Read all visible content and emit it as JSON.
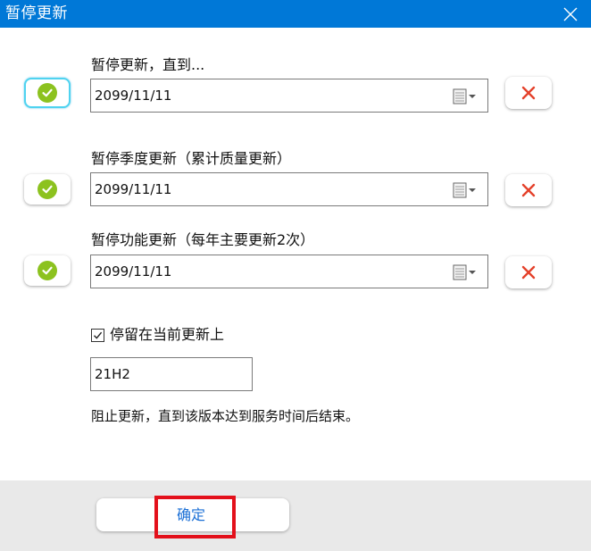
{
  "window": {
    "title": "暂停更新"
  },
  "sections": [
    {
      "label": "暂停更新，直到...",
      "date": "2099/11/11"
    },
    {
      "label": "暂停季度更新（累计质量更新）",
      "date": "2099/11/11"
    },
    {
      "label": "暂停功能更新（每年主要更新2次）",
      "date": "2099/11/11"
    }
  ],
  "stay": {
    "label": "停留在当前更新上",
    "checked": true,
    "version": "21H2"
  },
  "info": "阻止更新，直到该版本达到服务时间后结束。",
  "footer": {
    "ok_label": "确定"
  },
  "colors": {
    "titlebar": "#0078d7",
    "check_green": "#8cc21f",
    "x_red": "#e4412b",
    "ok_text": "#1a6fd6",
    "highlight": "#e3101b"
  },
  "icons": {
    "close": "close-icon",
    "check": "checkmark-icon",
    "remove": "x-icon",
    "calendar": "calendar-dropdown-icon",
    "checkbox": "checkbox-checked-icon"
  }
}
